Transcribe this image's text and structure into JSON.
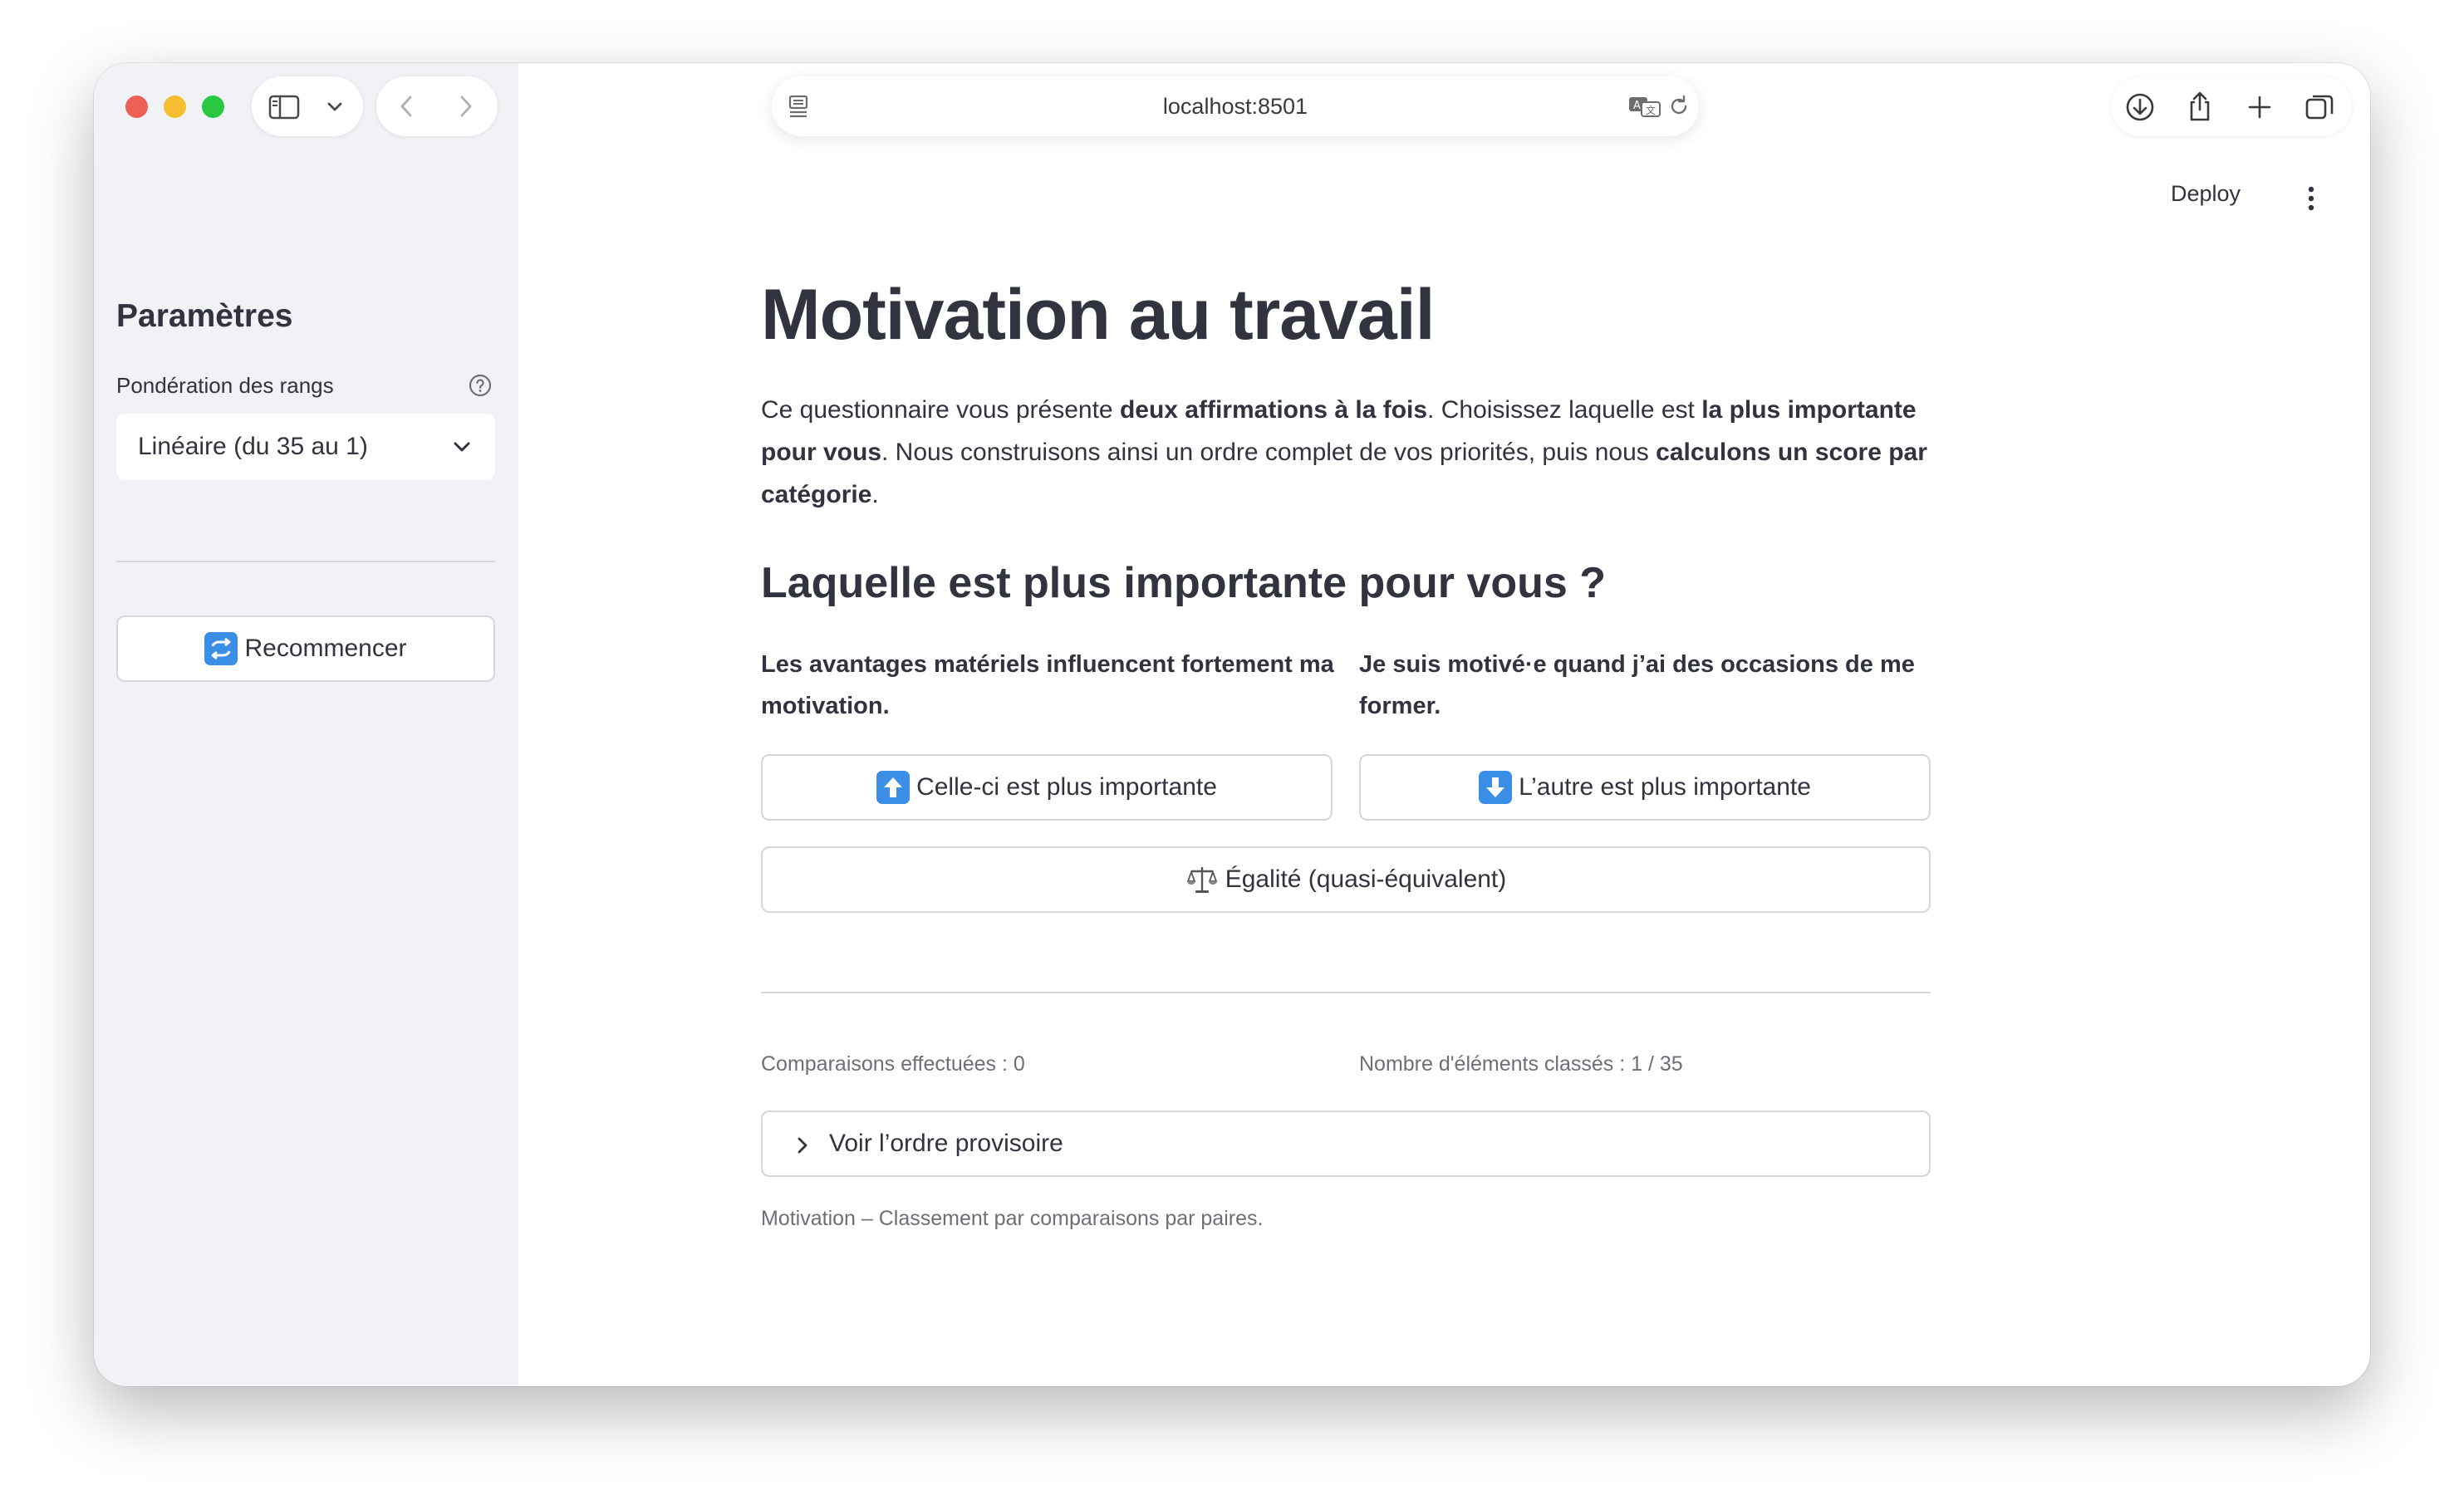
{
  "browser": {
    "url": "localhost:8501",
    "deploy_label": "Deploy"
  },
  "sidebar": {
    "title": "Paramètres",
    "weighting_label": "Pondération des rangs",
    "weighting_value": "Linéaire (du 35 au 1)",
    "restart_label": "Recommencer"
  },
  "main": {
    "title": "Motivation au travail",
    "intro": {
      "p1": "Ce questionnaire vous présente ",
      "b1": "deux affirmations à la fois",
      "p2": ". Choisissez laquelle est ",
      "b2": "la plus importante pour vous",
      "p3": ". Nous construisons ainsi un ordre complet de vos priorités, puis nous ",
      "b3": "calculons un score par catégorie",
      "p4": "."
    },
    "question": "Laquelle est plus importante pour vous ?",
    "statement_a": "Les avantages matériels influencent fortement ma motivation.",
    "statement_b": "Je suis motivé·e quand j’ai des occasions de me former.",
    "choose_a_label": "Celle-ci est plus importante",
    "choose_b_label": "L’autre est plus importante",
    "tie_label": "Égalité (quasi-équivalent)",
    "comparisons_text": "Comparaisons effectuées : 0",
    "ranked_text": "Nombre d'éléments classés : 1 / 35",
    "expander_label": "Voir l’ordre provisoire",
    "caption": "Motivation – Classement par comparaisons par paires."
  },
  "colors": {
    "sidebar_bg": "#f0f2f6",
    "text": "#31333f",
    "muted": "#6d6f78",
    "emoji_blue": "#3b8ee6",
    "traffic_red": "#ee5f57",
    "traffic_yellow": "#f5bd2f",
    "traffic_green": "#29c840"
  }
}
